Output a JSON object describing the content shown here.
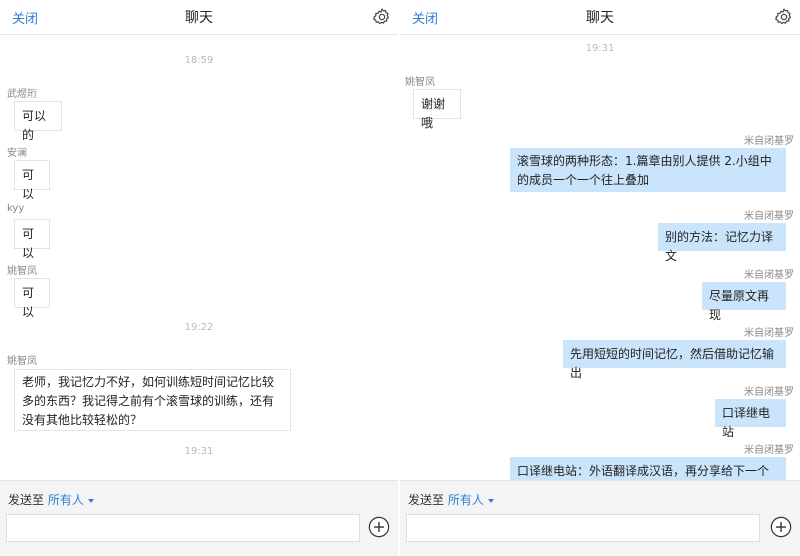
{
  "left": {
    "header": {
      "close_label": "关闭",
      "title": "聊天"
    },
    "timestamps": [
      "18:59",
      "19:22",
      "19:31"
    ],
    "messages": [
      {
        "sender": "武煜珩",
        "text": "可以的"
      },
      {
        "sender": "安澜",
        "text": "可以"
      },
      {
        "sender": "kyy",
        "text": "可以"
      },
      {
        "sender": "姚智凤",
        "text": "可以"
      },
      {
        "sender": "姚智凤",
        "text": "老师，我记忆力不好，如何训练短时间记忆比较多的东西？我记得之前有个滚雪球的训练，还有没有其他比较轻松的？"
      }
    ],
    "footer": {
      "send_to_label": "发送至",
      "recipient": "所有人"
    }
  },
  "right": {
    "header": {
      "close_label": "关闭",
      "title": "聊天"
    },
    "timestamp": "19:31",
    "messages": [
      {
        "sender": "姚智凤",
        "text": "谢谢哦"
      },
      {
        "sender": "米自闭基罗",
        "text": "滚雪球的两种形态：1.篇章由别人提供 2.小组中的成员一个一个往上叠加"
      },
      {
        "sender": "米自闭基罗",
        "text": "别的方法：记忆力译文"
      },
      {
        "sender": "米自闭基罗",
        "text": "尽量原文再现"
      },
      {
        "sender": "米自闭基罗",
        "text": "先用短短的时间记忆，然后借助记忆输出"
      },
      {
        "sender": "米自闭基罗",
        "text": "口译继电站"
      },
      {
        "sender": "米自闭基罗",
        "text": "口译继电站：外语翻译成汉语，再分享给下一个同"
      }
    ],
    "footer": {
      "send_to_label": "发送至",
      "recipient": "所有人"
    }
  },
  "icons": {
    "settings": "gear-icon",
    "add": "plus-circle-icon",
    "dropdown": "caret-down-icon"
  },
  "colors": {
    "link": "#2e7fd6",
    "own_bubble": "#c9e4fb",
    "timestamp": "#bbbbbb",
    "sender": "#888888"
  }
}
